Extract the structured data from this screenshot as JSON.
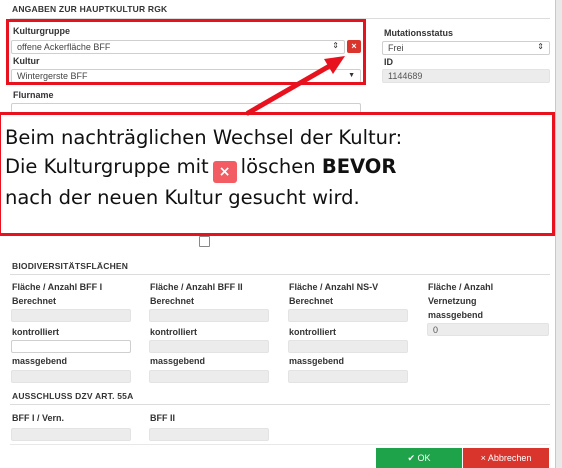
{
  "section_main": {
    "title": "ANGABEN ZUR HAUPTKULTUR RGK"
  },
  "kulturgruppe": {
    "label": "Kulturgruppe",
    "value": "offene Ackerfläche BFF",
    "clear_glyph": "×"
  },
  "kultur": {
    "label": "Kultur",
    "value": "Wintergerste BFF"
  },
  "mutationsstatus": {
    "label": "Mutationsstatus",
    "value": "Frei"
  },
  "id_field": {
    "label": "ID",
    "value": "1144689"
  },
  "flurname": {
    "label": "Flurname",
    "value": ""
  },
  "callout": {
    "line1": "Beim nachträglichen Wechsel der Kultur:",
    "line2_pre": "Die Kulturgruppe mit",
    "line2_icon": "×",
    "line2_mid": "löschen",
    "line2_bold": "BEVOR",
    "line3": "nach der neuen Kultur gesucht wird.",
    "accent_color": "#e8121e"
  },
  "biodiversity": {
    "title": "BIODIVERSITÄTSFLÄCHEN",
    "columns": [
      {
        "heading1": "Fläche / Anzahl BFF I",
        "heading2": "Berechnet",
        "kontrolliert": "kontrolliert",
        "massgebend": "massgebend"
      },
      {
        "heading1": "Fläche / Anzahl BFF II",
        "heading2": "Berechnet",
        "kontrolliert": "kontrolliert",
        "massgebend": "massgebend"
      },
      {
        "heading1": "Fläche / Anzahl NS-V",
        "heading2": "Berechnet",
        "kontrolliert": "kontrolliert",
        "massgebend": "massgebend"
      },
      {
        "heading1": "Fläche / Anzahl",
        "heading2": "Vernetzung",
        "heading3": "massgebend",
        "value": "0"
      }
    ]
  },
  "exclusion": {
    "title": "AUSSCHLUSS DZV ART. 55A",
    "field1_label": "BFF I / Vern.",
    "field2_label": "BFF II"
  },
  "buttons": {
    "ok_icon": "✔",
    "ok_label": "OK",
    "ok_color": "#1fa34a",
    "cancel_icon": "×",
    "cancel_label": "Abbrechen",
    "cancel_color": "#d9352d"
  }
}
